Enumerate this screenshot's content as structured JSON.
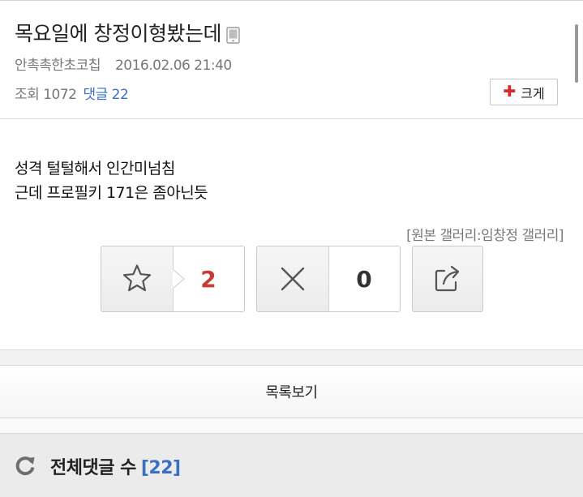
{
  "post": {
    "title": "목요일에 창정이형봤는데",
    "title_icon": "mobile-phone-icon",
    "author": "안촉촉한초코칩",
    "datetime": "2016.02.06 21:40",
    "views_label": "조회",
    "views": "1072",
    "comments_label": "댓글",
    "comments": "22",
    "enlarge_label": "크게",
    "body_lines": [
      "성격 털털해서 인간미넘침",
      "근데 프로필키 171은 좀아닌듯"
    ],
    "source": "[원본 갤러리:임창정 갤러리]"
  },
  "votes": {
    "recommend_icon": "star-icon",
    "recommend_count": "2",
    "nonrecommend_icon": "x-icon",
    "nonrecommend_count": "0",
    "share_icon": "share-icon"
  },
  "list_button": "목록보기",
  "comment_section": {
    "icon": "refresh-icon",
    "label": "전체댓글 수",
    "count": "[22]"
  },
  "colors": {
    "accent_blue": "#3a6fc4",
    "recommend_red": "#c83a34",
    "plus_red": "#d8282d"
  }
}
